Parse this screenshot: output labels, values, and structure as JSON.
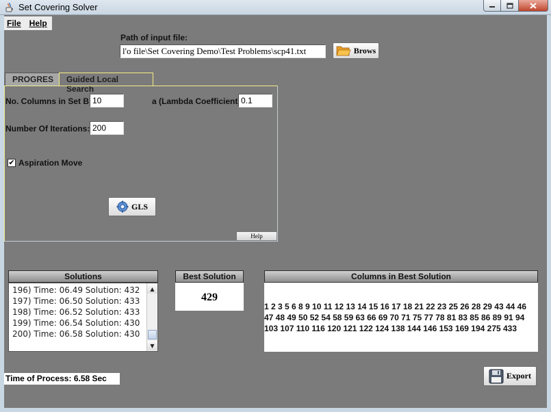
{
  "window": {
    "title": "Set Covering Solver",
    "icons": {
      "app": "java-coffee-icon",
      "minimize": "minimize-icon",
      "maximize": "maximize-icon",
      "close": "close-icon"
    }
  },
  "menu": {
    "file": "File",
    "help": "Help"
  },
  "input": {
    "label": "Path of input file:",
    "path": "l'o  file\\Set Covering Demo\\Test Problems\\scp41.txt",
    "browse_label": "Brows",
    "browse_icon": "folder-open-icon"
  },
  "tabs": [
    {
      "label": "PROGRES",
      "selected": false
    },
    {
      "label": "Guided Local Search",
      "selected": true
    }
  ],
  "gls": {
    "columns_label": "No. Columns in Set B:",
    "columns_value": "10",
    "lambda_label": "a (Lambda Coefficient):",
    "lambda_value": "0.1",
    "iterations_label": "Number Of Iterations:",
    "iterations_value": "200",
    "aspiration_label": "Aspiration Move",
    "aspiration_checked": true,
    "run_label": "GLS",
    "run_icon": "gear-icon",
    "help_label": "Help"
  },
  "solutions": {
    "header": "Solutions",
    "items": [
      "196) Time: 06.49  Solution: 432",
      "197) Time: 06.50  Solution: 433",
      "198) Time: 06.52  Solution: 433",
      "199) Time: 06.54  Solution: 430",
      "200) Time: 06.58  Solution: 430"
    ]
  },
  "best": {
    "header": "Best Solution",
    "value": "429"
  },
  "columns": {
    "header": "Columns in Best Solution",
    "line1": "1 2 3 5 6 8 9 10 11 12 13 14 15 16 17 18 21 22 23 25 26 28 29 43 44 46",
    "line2": "47 48 49 50 52 54 58 59 63 66 69 70 71 75 77 78 81 83 85 86 89 91 94",
    "line3": "103 107 110 116 120 121 122 124 138 144 146 153 169 194 275 433"
  },
  "status": {
    "time": "Time of Process: 6.58 Sec"
  },
  "export": {
    "label": "Export",
    "icon": "floppy-disk-icon"
  }
}
